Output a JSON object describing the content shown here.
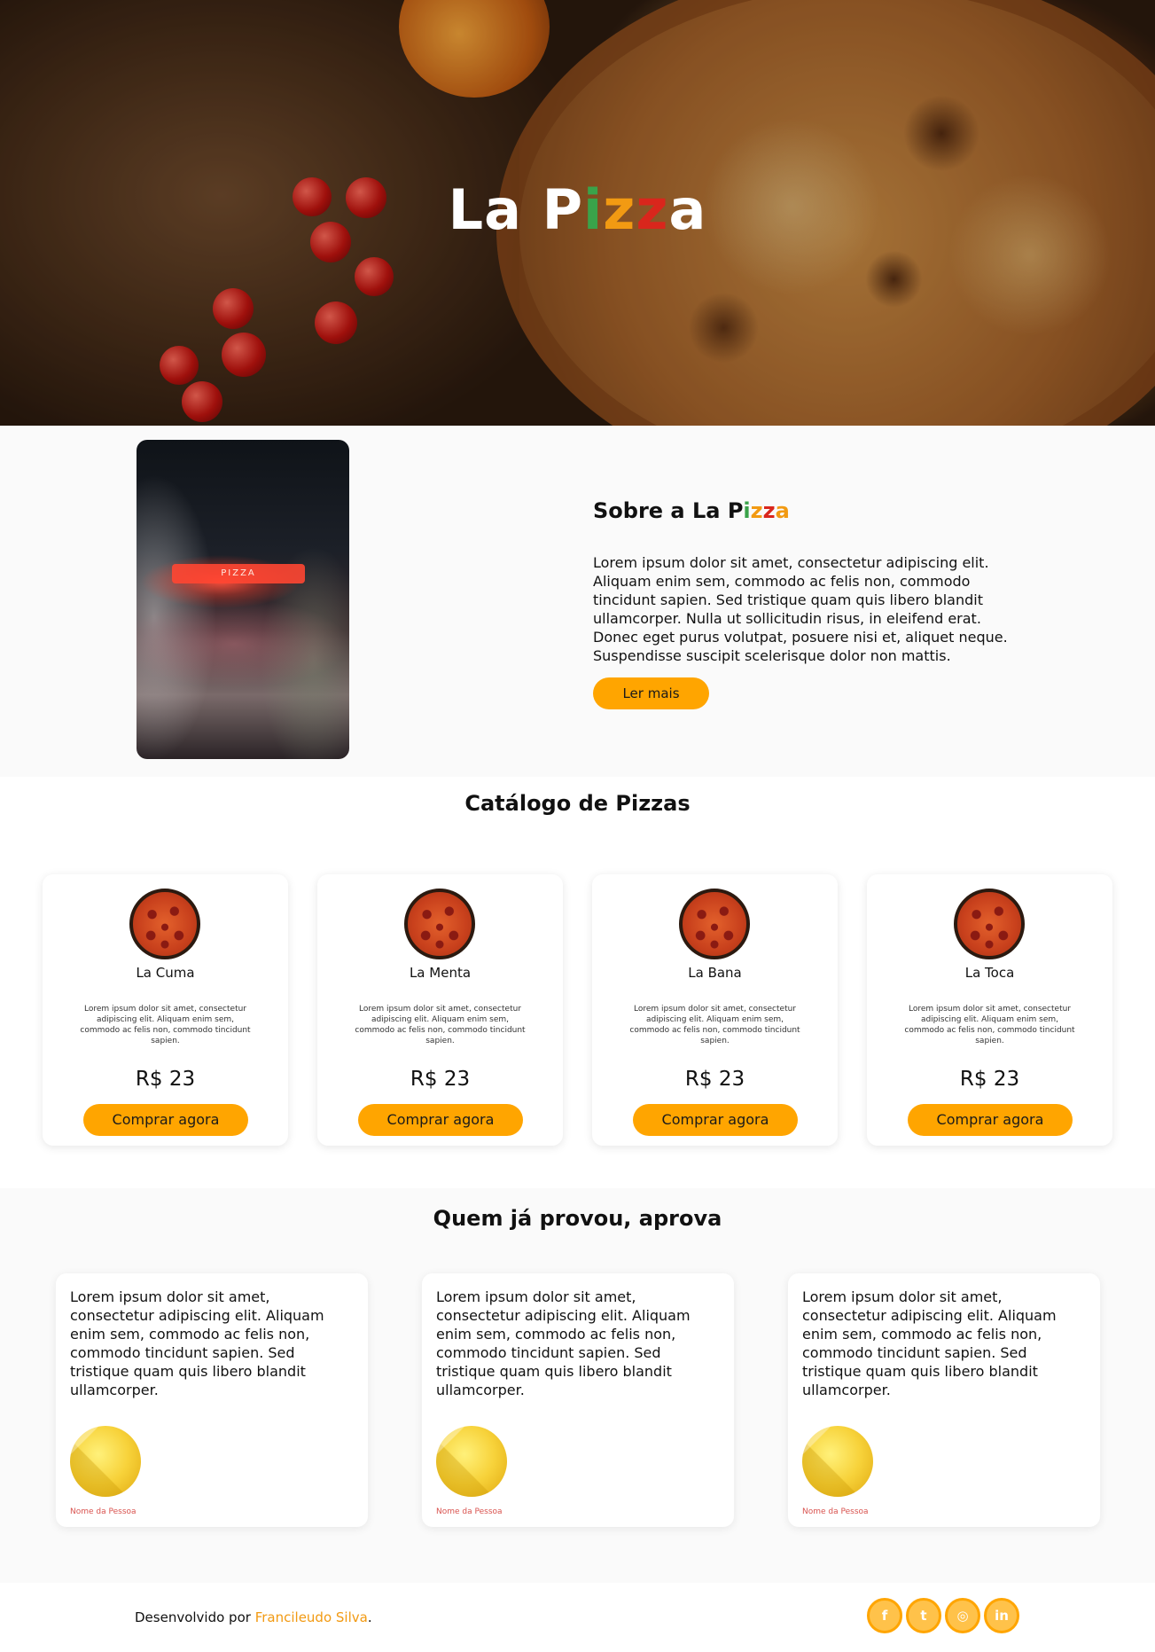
{
  "hero": {
    "title_part1": "La P",
    "title_i": "i",
    "title_z1": "z",
    "title_z2": "z",
    "title_a": "a"
  },
  "about": {
    "title_prefix": "Sobre a La P",
    "title_i": "i",
    "title_z1": "z",
    "title_z2": "z",
    "title_a": "a",
    "body": "Lorem ipsum dolor sit amet, consectetur adipiscing elit. Aliquam enim sem, commodo ac felis non, commodo tincidunt sapien. Sed tristique quam quis libero blandit ullamcorper. Nulla ut sollicitudin risus, in eleifend erat. Donec eget purus volutpat, posuere nisi et, aliquet neque. Suspendisse suscipit scelerisque dolor non mattis.",
    "button": "Ler mais"
  },
  "catalog": {
    "title": "Catálogo de Pizzas",
    "items": [
      {
        "name": "La Cuma",
        "desc": "Lorem ipsum dolor sit amet, consectetur adipiscing elit. Aliquam enim sem, commodo ac felis non, commodo tincidunt sapien.",
        "price": "R$ 23",
        "button": "Comprar agora"
      },
      {
        "name": "La Menta",
        "desc": "Lorem ipsum dolor sit amet, consectetur adipiscing elit. Aliquam enim sem, commodo ac felis non, commodo tincidunt sapien.",
        "price": "R$ 23",
        "button": "Comprar agora"
      },
      {
        "name": "La Bana",
        "desc": "Lorem ipsum dolor sit amet, consectetur adipiscing elit. Aliquam enim sem, commodo ac felis non, commodo tincidunt sapien.",
        "price": "R$ 23",
        "button": "Comprar agora"
      },
      {
        "name": "La Toca",
        "desc": "Lorem ipsum dolor sit amet, consectetur adipiscing elit. Aliquam enim sem, commodo ac felis non, commodo tincidunt sapien.",
        "price": "R$ 23",
        "button": "Comprar agora"
      }
    ]
  },
  "testimonials": {
    "title": "Quem já provou, aprova",
    "items": [
      {
        "text": "Lorem ipsum dolor sit amet, consectetur adipiscing elit. Aliquam enim sem, commodo ac felis non, commodo tincidunt sapien. Sed tristique quam quis libero blandit ullamcorper.",
        "name": "Nome da Pessoa"
      },
      {
        "text": "Lorem ipsum dolor sit amet, consectetur adipiscing elit. Aliquam enim sem, commodo ac felis non, commodo tincidunt sapien. Sed tristique quam quis libero blandit ullamcorper.",
        "name": "Nome da Pessoa"
      },
      {
        "text": "Lorem ipsum dolor sit amet, consectetur adipiscing elit. Aliquam enim sem, commodo ac felis non, commodo tincidunt sapien. Sed tristique quam quis libero blandit ullamcorper.",
        "name": "Nome da Pessoa"
      }
    ]
  },
  "footer": {
    "prefix": "Desenvolvido por ",
    "author": "Francileudo Silva",
    "suffix": ".",
    "socials": [
      {
        "icon": "facebook-icon",
        "glyph": "f"
      },
      {
        "icon": "twitter-icon",
        "glyph": "t"
      },
      {
        "icon": "instagram-icon",
        "glyph": "◎"
      },
      {
        "icon": "linkedin-icon",
        "glyph": "in"
      }
    ]
  },
  "colors": {
    "accent": "#ffa500",
    "italy_green": "#3aa34a",
    "italy_orange": "#f29a12",
    "italy_red": "#d9261c",
    "name_red": "#d9534f"
  }
}
